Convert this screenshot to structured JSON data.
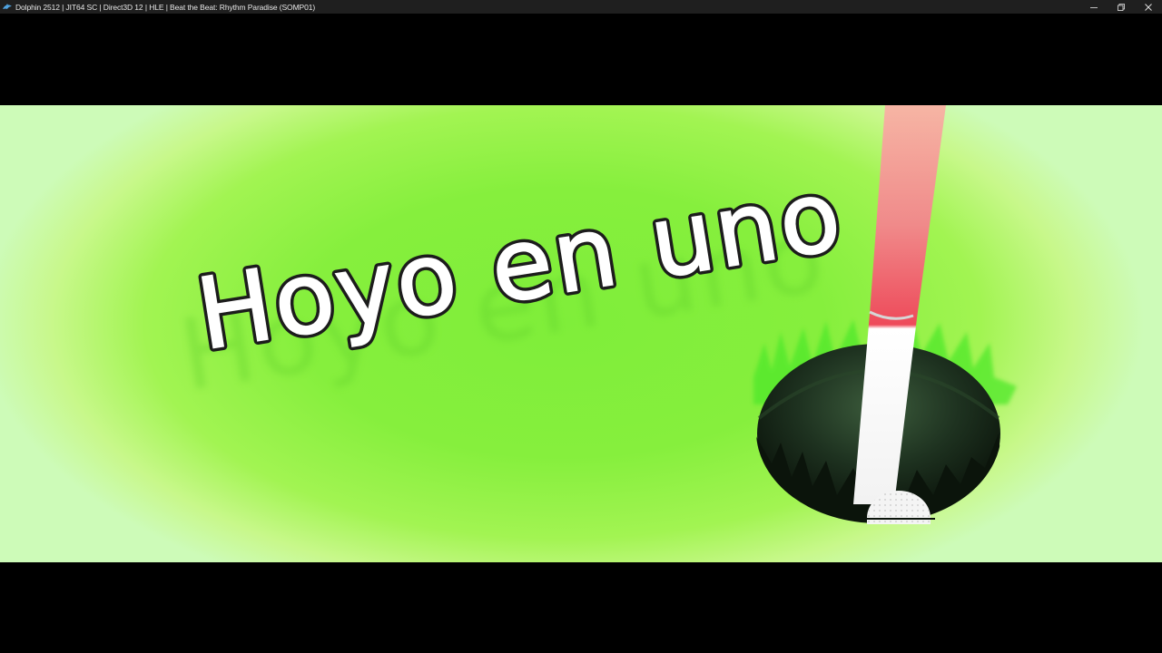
{
  "window": {
    "title": "Dolphin 2512 | JIT64 SC | Direct3D 12 | HLE | Beat the Beat: Rhythm Paradise (SOMP01)",
    "app_icon": "dolphin-icon",
    "controls": [
      "minimize-icon",
      "restore-icon",
      "close-icon"
    ]
  },
  "game": {
    "title_card": "Hoyo en uno",
    "colors": {
      "background_center": "#7fee3a",
      "background_edge": "#cdfbb8",
      "title_fill": "#ffffff",
      "title_outline": "#1c1c1c",
      "flag_pole_top": "#f6b5a4",
      "flag_pole_mid": "#ee4a5a",
      "flag_pole_bottom": "#ffffff",
      "hole_dark": "#101a10",
      "golf_ball": "#f4f4f4"
    },
    "objects": [
      "golf-hole",
      "flag-pole",
      "golf-ball"
    ]
  }
}
